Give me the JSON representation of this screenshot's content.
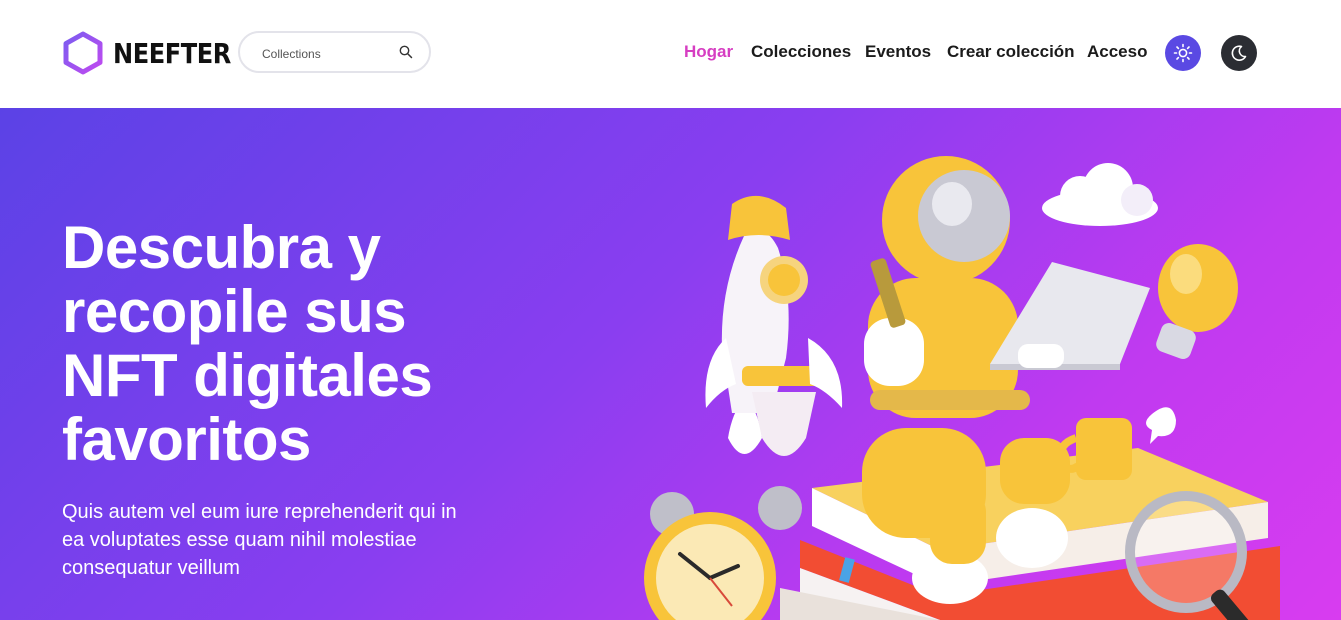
{
  "brand": {
    "name": "NEEFTER",
    "logo_icon": "hexagon-logo-icon",
    "accent": "#9b4df0"
  },
  "search": {
    "placeholder": "Collections",
    "icon": "search-icon"
  },
  "nav": {
    "items": [
      {
        "label": "Hogar",
        "active": true
      },
      {
        "label": "Colecciones",
        "active": false
      },
      {
        "label": "Eventos",
        "active": false
      },
      {
        "label": "Crear colección",
        "active": false
      },
      {
        "label": "Acceso",
        "active": false
      }
    ],
    "active_color": "#d63ec2"
  },
  "theme_toggle": {
    "light": {
      "icon": "sun-icon",
      "color": "#5a49e3"
    },
    "dark": {
      "icon": "moon-icon",
      "color": "#2b2d33"
    }
  },
  "hero": {
    "title": "Descubra y recopile sus NFT digitales favoritos",
    "subtitle": "Quis autem vel eum iure reprehenderit qui in ea voluptates esse quam nihil molestiae consequatur veillum",
    "gradient": [
      "#5b42e6",
      "#d83cf0"
    ],
    "illustration": "astronaut-on-books-illustration"
  }
}
